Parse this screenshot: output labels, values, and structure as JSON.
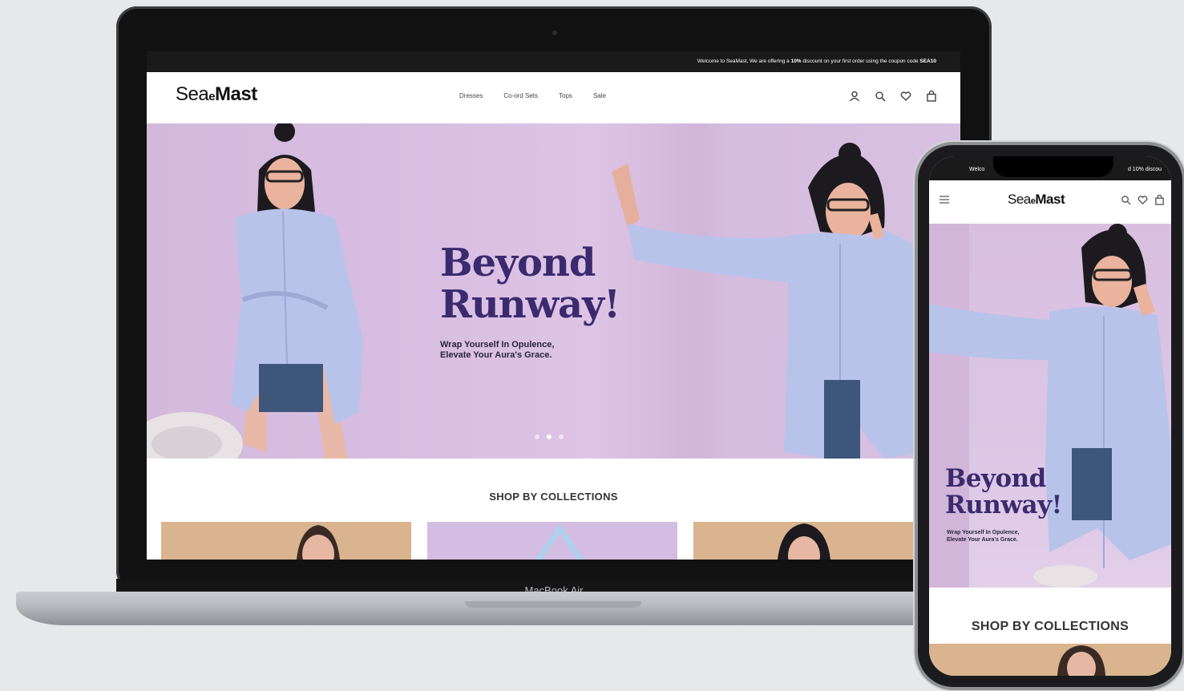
{
  "announcement": {
    "text": "Welcome to SeaMast, We are offering a",
    "highlight": "10%",
    "text_after": "discount on your first order using the coupon code",
    "code": "SEA10"
  },
  "brand": {
    "sea": "Sea",
    "e": "e",
    "mast": "Mast"
  },
  "nav": {
    "items": [
      "Dresses",
      "Co-ord Sets",
      "Tops",
      "Sale"
    ]
  },
  "header_icons": [
    "user-icon",
    "search-icon",
    "heart-icon",
    "bag-icon"
  ],
  "hero": {
    "title_line1": "Beyond",
    "title_line2": "Runway!",
    "subtitle_line1": "Wrap Yourself In Opulence,",
    "subtitle_line2": "Elevate Your Aura's Grace.",
    "slides": 3,
    "active_slide": 2
  },
  "collections": {
    "title": "SHOP BY COLLECTIONS"
  },
  "device": {
    "laptop_label": "MacBook Air"
  },
  "phone": {
    "status_left": "Welco",
    "status_right": "d 10% discou",
    "title_line1": "Beyond",
    "title_line2": "Runway!",
    "subtitle_line1": "Wrap Yourself In Opulence,",
    "subtitle_line2": "Elevate Your Aura's Grace.",
    "section_title": "SHOP BY COLLECTIONS"
  },
  "colors": {
    "accent": "#3a2b6e",
    "hero_bg": "#d8bfe0",
    "announce_bg": "#1a1a1a",
    "card_tan": "#d9b48e",
    "card_lilac": "#d4bde3"
  }
}
